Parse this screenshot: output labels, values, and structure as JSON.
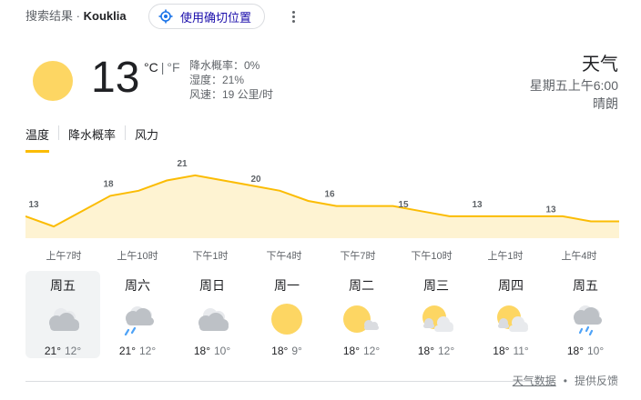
{
  "header": {
    "breadcrumb": "搜索结果",
    "separator": "·",
    "location": "Kouklia",
    "precise_location_label": "使用确切位置"
  },
  "current": {
    "temperature": "13",
    "unit_c": "°C",
    "unit_sep": "|",
    "unit_f": "°F",
    "precip": "降水概率：0%",
    "humidity": "湿度：21%",
    "wind": "风速：19 公里/时",
    "title": "天气",
    "datetime": "星期五上午6:00",
    "condition": "晴朗"
  },
  "tabs": [
    {
      "label": "温度"
    },
    {
      "label": "降水概率"
    },
    {
      "label": "风力"
    }
  ],
  "chart_data": {
    "type": "area",
    "series": [
      {
        "values": [
          13,
          11,
          14,
          17,
          18,
          20,
          21,
          20,
          19,
          18,
          16,
          15,
          15,
          15,
          14,
          13,
          13,
          13,
          13,
          13,
          12,
          12
        ]
      }
    ],
    "data_labels": [
      "13",
      "18",
      "21",
      "20",
      "16",
      "15",
      "13",
      "13"
    ],
    "x_tick_labels": [
      "上午7时",
      "上午10时",
      "下午1时",
      "下午4时",
      "下午7时",
      "下午10时",
      "上午1时",
      "上午4时"
    ],
    "ylim": [
      8,
      24
    ],
    "colors": {
      "line": "#fbbc04",
      "fill": "#fef3d2"
    }
  },
  "days": [
    {
      "name": "周五",
      "icon": "cloudy-icon",
      "high": "21°",
      "low": "12°"
    },
    {
      "name": "周六",
      "icon": "rain-cloud-icon",
      "high": "21°",
      "low": "12°"
    },
    {
      "name": "周日",
      "icon": "cloudy-icon",
      "high": "18°",
      "low": "10°"
    },
    {
      "name": "周一",
      "icon": "sun-icon",
      "high": "18°",
      "low": "9°"
    },
    {
      "name": "周二",
      "icon": "sun-cloud-icon",
      "high": "18°",
      "low": "12°"
    },
    {
      "name": "周三",
      "icon": "partly-cloudy-icon",
      "high": "18°",
      "low": "12°"
    },
    {
      "name": "周四",
      "icon": "partly-cloudy-icon",
      "high": "18°",
      "low": "11°"
    },
    {
      "name": "周五",
      "icon": "showers-icon",
      "high": "18°",
      "low": "10°"
    }
  ],
  "footer": {
    "data_link": "天气数据",
    "separator": "•",
    "feedback_link": "提供反馈"
  }
}
